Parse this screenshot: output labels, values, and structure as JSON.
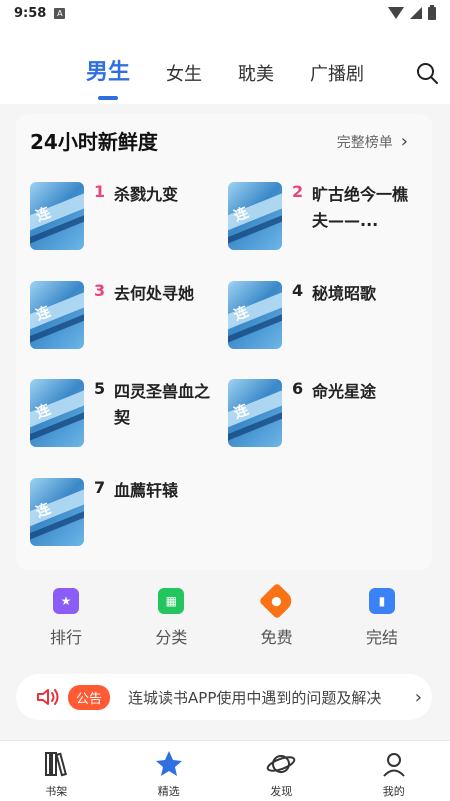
{
  "status": {
    "time": "9:58",
    "app_icon": "A"
  },
  "tabs": [
    {
      "label": "男生",
      "active": true
    },
    {
      "label": "女生",
      "active": false
    },
    {
      "label": "耽美",
      "active": false
    },
    {
      "label": "广播剧",
      "active": false
    }
  ],
  "ranking": {
    "title": "24小时新鲜度",
    "more_label": "完整榜单",
    "books": [
      {
        "rank": "1",
        "title": "杀戮九变"
      },
      {
        "rank": "2",
        "title": "旷古绝今一樵夫——..."
      },
      {
        "rank": "3",
        "title": "去何处寻她"
      },
      {
        "rank": "4",
        "title": "秘境昭歌"
      },
      {
        "rank": "5",
        "title": "四灵圣兽血之契"
      },
      {
        "rank": "6",
        "title": "命光星途"
      },
      {
        "rank": "7",
        "title": "血薦轩辕"
      }
    ]
  },
  "quick_links": [
    {
      "label": "排行",
      "icon": "ranking-icon",
      "color": "#8b5cf6"
    },
    {
      "label": "分类",
      "icon": "category-icon",
      "color": "#22c55e"
    },
    {
      "label": "免费",
      "icon": "free-tag-icon",
      "color": "#f97316"
    },
    {
      "label": "完结",
      "icon": "book-complete-icon",
      "color": "#3b82f6"
    }
  ],
  "notice": {
    "badge": "公告",
    "text": "连城读书APP使用中遇到的问题及解决"
  },
  "bottom_nav": [
    {
      "label": "书架",
      "icon": "bookshelf-icon"
    },
    {
      "label": "精选",
      "icon": "star-icon",
      "active": true
    },
    {
      "label": "发现",
      "icon": "planet-icon"
    },
    {
      "label": "我的",
      "icon": "profile-icon"
    }
  ],
  "colors": {
    "accent": "#2f6fe0",
    "hot_rank": "#e8457a",
    "notice_badge": "#ff5a33"
  }
}
